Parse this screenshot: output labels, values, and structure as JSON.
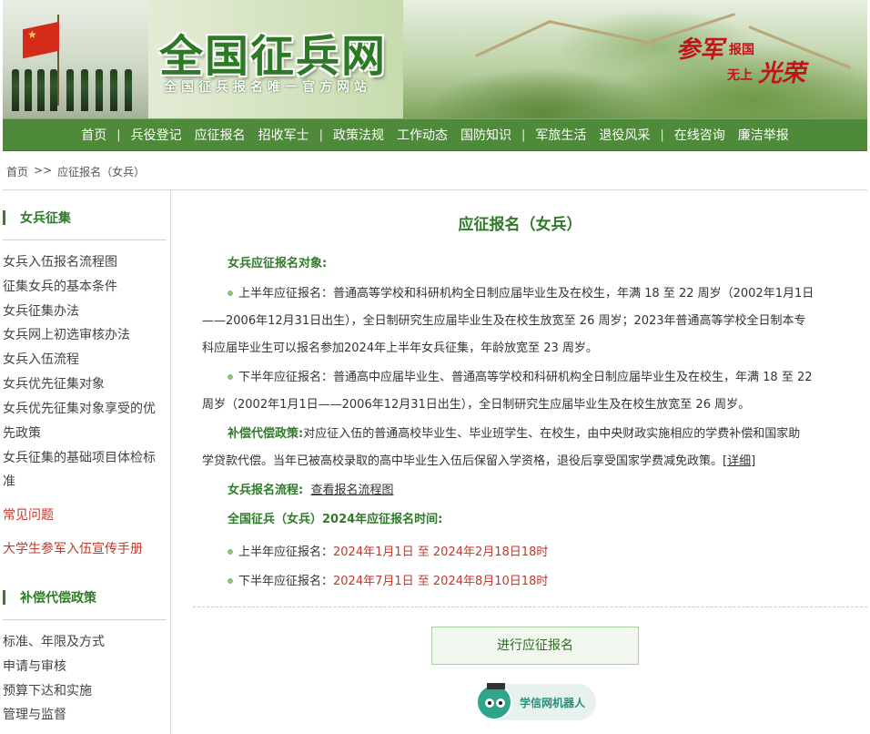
{
  "header": {
    "title": "全国征兵网",
    "subtitle": "全国征兵报名唯一官方网站",
    "slogan": {
      "a": "参军",
      "b": "报国",
      "c": "无上",
      "d": "光荣"
    }
  },
  "nav": {
    "items": [
      "首页",
      "兵役登记",
      "应征报名",
      "招收军士",
      "政策法规",
      "工作动态",
      "国防知识",
      "军旅生活",
      "退役风采",
      "在线咨询",
      "廉洁举报"
    ]
  },
  "breadcrumb": {
    "home": "首页",
    "sep": ">>",
    "current": "应征报名（女兵）"
  },
  "sidebar": {
    "section1_title": "女兵征集",
    "section1_items": [
      "女兵入伍报名流程图",
      "征集女兵的基本条件",
      "女兵征集办法",
      "女兵网上初选审核办法",
      "女兵入伍流程",
      "女兵优先征集对象",
      "女兵优先征集对象享受的优",
      "先政策",
      "女兵征集的基础项目体检标",
      "准"
    ],
    "faq": "常见问题",
    "handbook": "大学生参军入伍宣传手册",
    "section2_title": "补偿代偿政策",
    "section2_items": [
      "标准、年限及方式",
      "申请与审核",
      "预算下达和实施",
      "管理与监督"
    ]
  },
  "main": {
    "title": "应征报名（女兵）",
    "target_head": "女兵应征报名对象:",
    "first_half_p1": "上半年应征报名：普通高等学校和科研机构全日制应届毕业生及在校生，年满 18 至 22 周岁（2002年1月1日",
    "first_half_p2": "——2006年12月31日出生），全日制研究生应届毕业生及在校生放宽至 26 周岁；2023年普通高等学校全日制本专",
    "first_half_p3": "科应届毕业生可以报名参加2024年上半年女兵征集，年龄放宽至 23 周岁。",
    "second_half_p1": "下半年应征报名：普通高中应届毕业生、普通高等学校和科研机构全日制应届毕业生及在校生，年满 18 至 22",
    "second_half_p2": "周岁（2002年1月1日——2006年12月31日出生），全日制研究生应届毕业生及在校生放宽至 26 周岁。",
    "comp_head": "补偿代偿政策:",
    "comp_p1": "对应征入伍的普通高校毕业生、毕业班学生、在校生，由中央财政实施相应的学费补偿和国家助",
    "comp_p2": "学贷款代偿。当年已被高校录取的高中毕业生入伍后保留入学资格，退役后享受国家学费减免政策。",
    "comp_detail": "[详细]",
    "flow_head": "女兵报名流程:",
    "flow_link": "查看报名流程图",
    "time_head": "全国征兵（女兵）2024年应征报名时间:",
    "time1_label": "上半年应征报名：",
    "time1_value": "2024年1月1日 至 2024年2月18日18时",
    "time2_label": "下半年应征报名：",
    "time2_value": "2024年7月1日 至 2024年8月10日18时"
  },
  "register_button": "进行应征报名",
  "robot": {
    "label": "学信网机器人"
  },
  "colors": {
    "primary_green": "#4f8a3b",
    "title_green": "#2f7a28",
    "accent_red": "#c0392b"
  }
}
